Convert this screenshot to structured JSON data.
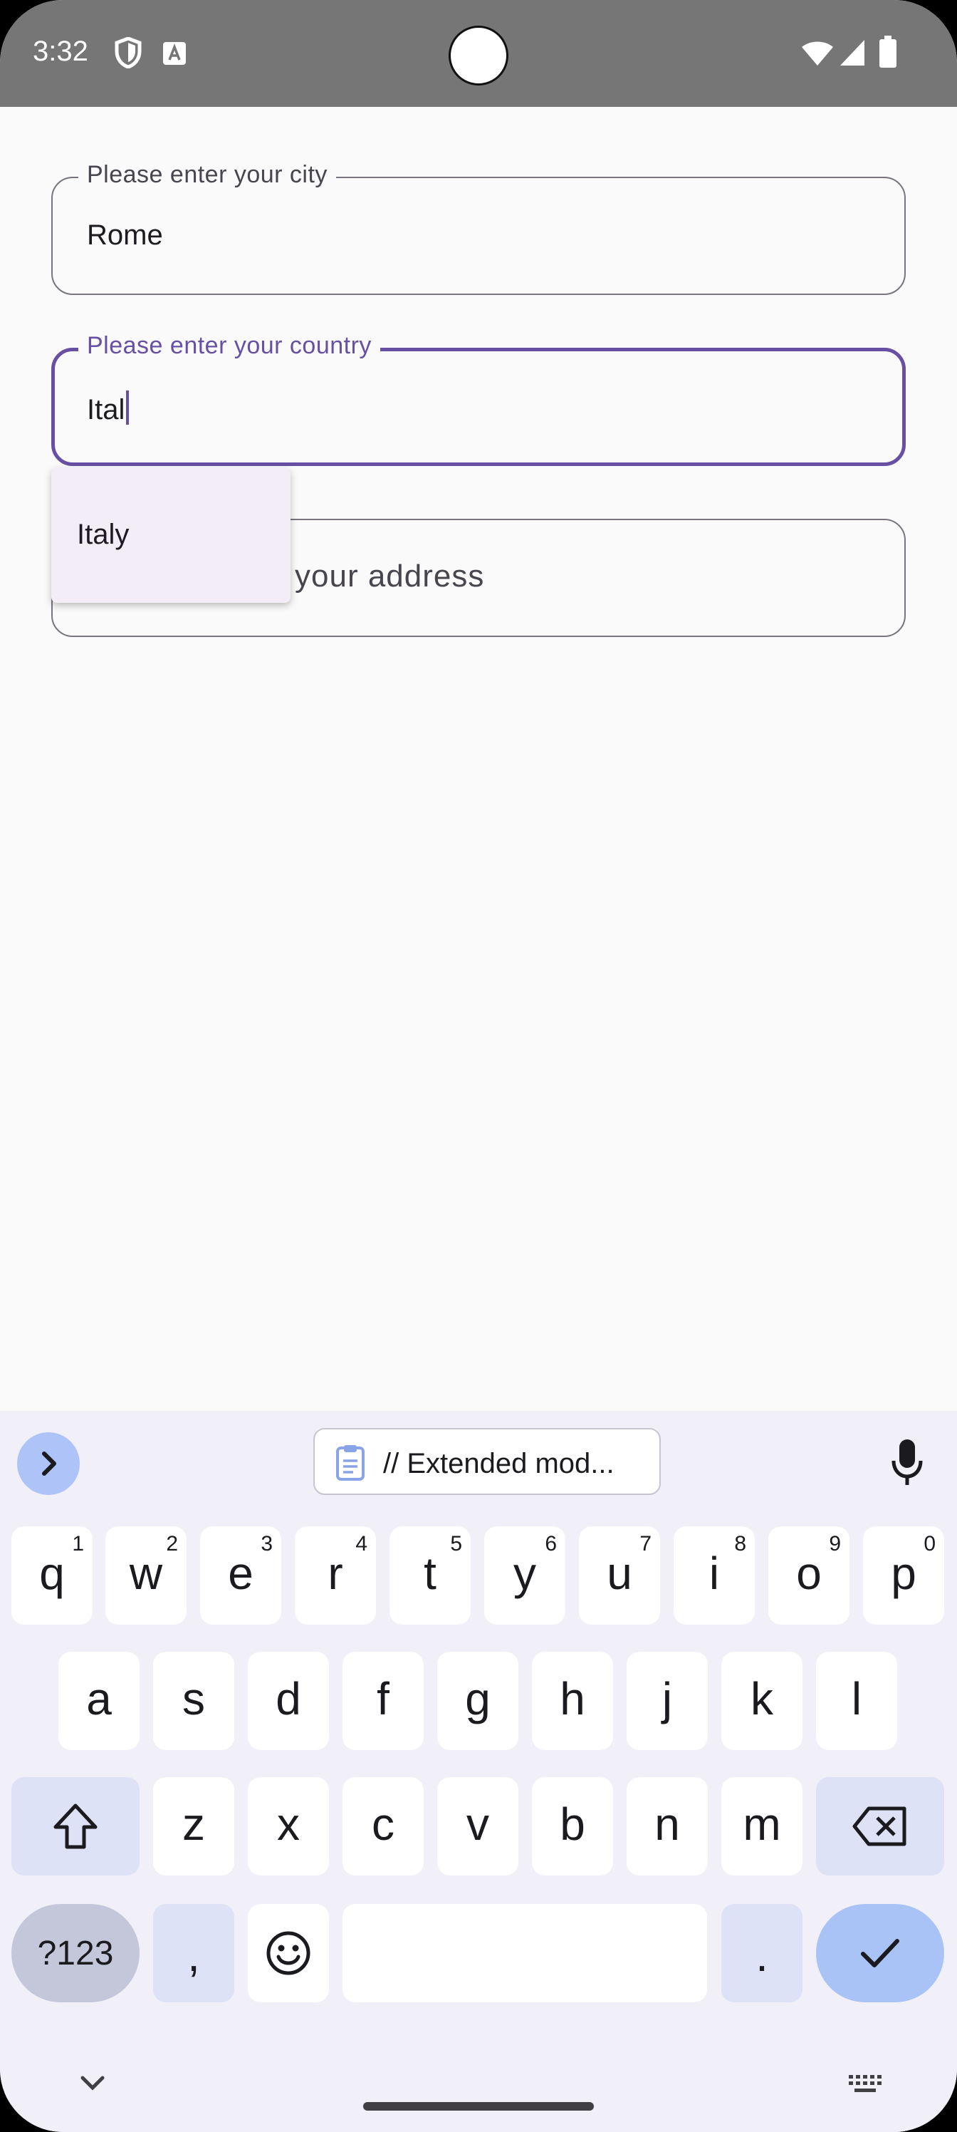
{
  "status_bar": {
    "time": "3:32"
  },
  "form": {
    "city": {
      "label": "Please enter your city",
      "value": "Rome"
    },
    "country": {
      "label": "Please enter your country",
      "value": "Ital"
    },
    "address": {
      "placeholder_visible": "your address"
    }
  },
  "autocomplete": {
    "items": [
      "Italy"
    ]
  },
  "keyboard": {
    "clipboard_suggestion": "// Extended mod...",
    "row1": [
      {
        "ch": "q",
        "num": "1"
      },
      {
        "ch": "w",
        "num": "2"
      },
      {
        "ch": "e",
        "num": "3"
      },
      {
        "ch": "r",
        "num": "4"
      },
      {
        "ch": "t",
        "num": "5"
      },
      {
        "ch": "y",
        "num": "6"
      },
      {
        "ch": "u",
        "num": "7"
      },
      {
        "ch": "i",
        "num": "8"
      },
      {
        "ch": "o",
        "num": "9"
      },
      {
        "ch": "p",
        "num": "0"
      }
    ],
    "row2": [
      "a",
      "s",
      "d",
      "f",
      "g",
      "h",
      "j",
      "k",
      "l"
    ],
    "row3": [
      "z",
      "x",
      "c",
      "v",
      "b",
      "n",
      "m"
    ],
    "symbols_label": "?123",
    "comma": ",",
    "period": "."
  },
  "colors": {
    "accent": "#6750a4",
    "status_bar": "#767676",
    "keyboard_bg": "#f1eff7"
  }
}
